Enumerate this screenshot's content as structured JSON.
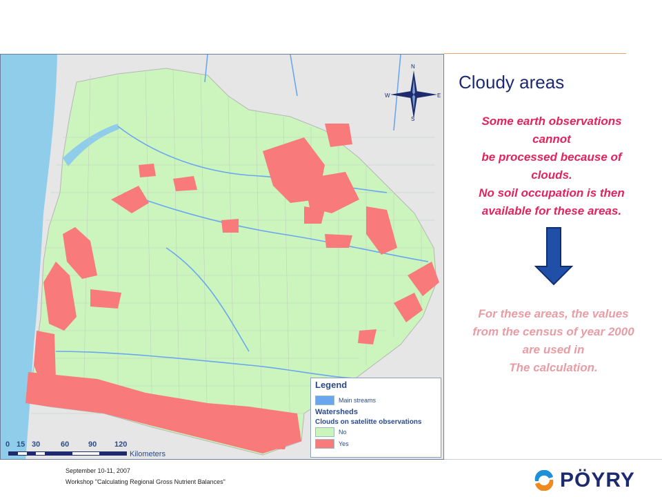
{
  "title": "Cloudy areas",
  "message_lines": [
    "Some earth observations",
    "cannot",
    "be processed because of",
    "clouds.",
    "No soil occupation is then",
    "available for these areas."
  ],
  "note_lines": [
    "For these areas, the values",
    "from the census of year 2000",
    "are used in",
    "The calculation."
  ],
  "legend": {
    "title": "Legend",
    "main_streams": "Main streams",
    "watersheds": "Watersheds",
    "clouds": "Clouds on satelitte observations",
    "no": "No",
    "yes": "Yes"
  },
  "scale": {
    "ticks": [
      "0",
      "15",
      "30",
      "60",
      "90",
      "120"
    ],
    "unit": "Kilometers"
  },
  "compass": {
    "n": "N",
    "s": "S",
    "e": "E",
    "w": "W"
  },
  "footer": {
    "date": "September 10-11, 2007",
    "workshop": "Workshop \"Calculating Regional Gross Nutrient Balances\""
  },
  "logo": {
    "text": "PÖYRY"
  },
  "colors": {
    "no_cloud": "#ccf5bd",
    "cloud": "#f87a7a",
    "stream": "#6aa6ef",
    "sea": "#8fcdea",
    "title": "#1d2b6e",
    "message": "#e0245e",
    "note": "#e89ca4",
    "arrow": "#1f4fa6"
  }
}
